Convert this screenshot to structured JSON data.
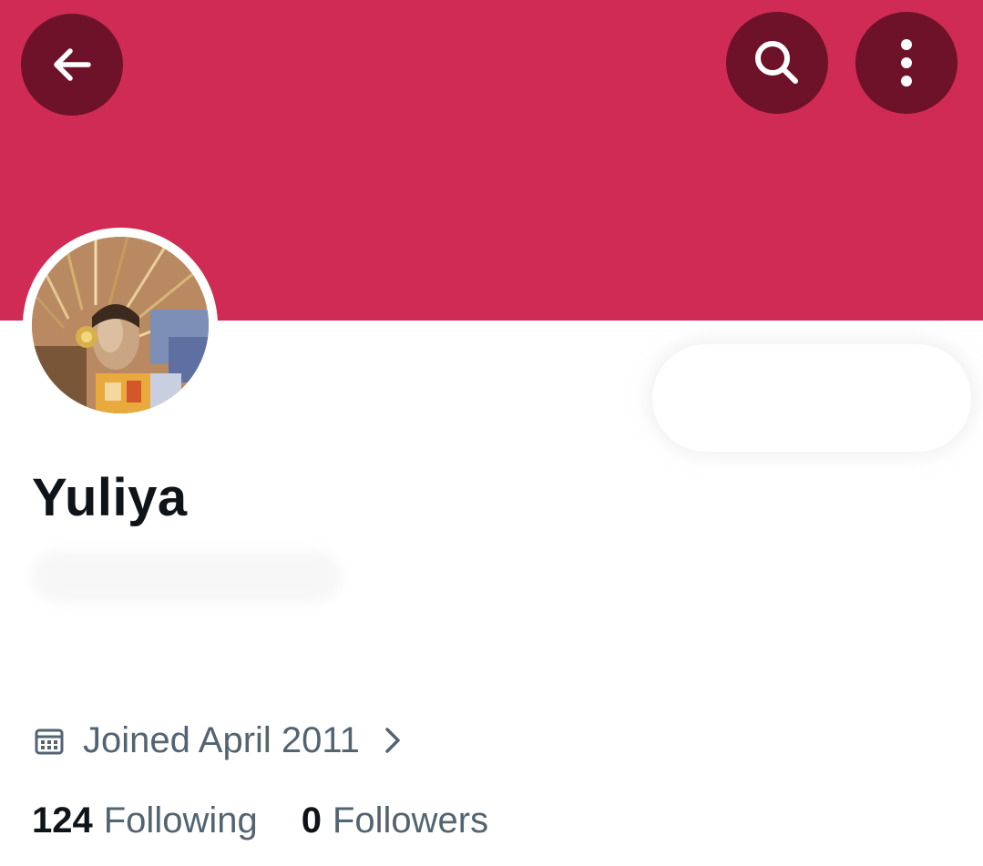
{
  "colors": {
    "banner": "#cf2b55",
    "button_bg": "#6e1229",
    "text_primary": "#0f1419",
    "text_secondary": "#536471"
  },
  "header": {
    "back_icon": "arrow-left-icon",
    "search_icon": "search-icon",
    "more_icon": "more-vertical-icon"
  },
  "profile": {
    "display_name": "Yuliya",
    "joined": "Joined April 2011",
    "joined_icon": "calendar-icon",
    "joined_chevron": "chevron-right-icon",
    "following_count": "124",
    "following_label": "Following",
    "followers_count": "0",
    "followers_label": "Followers"
  }
}
